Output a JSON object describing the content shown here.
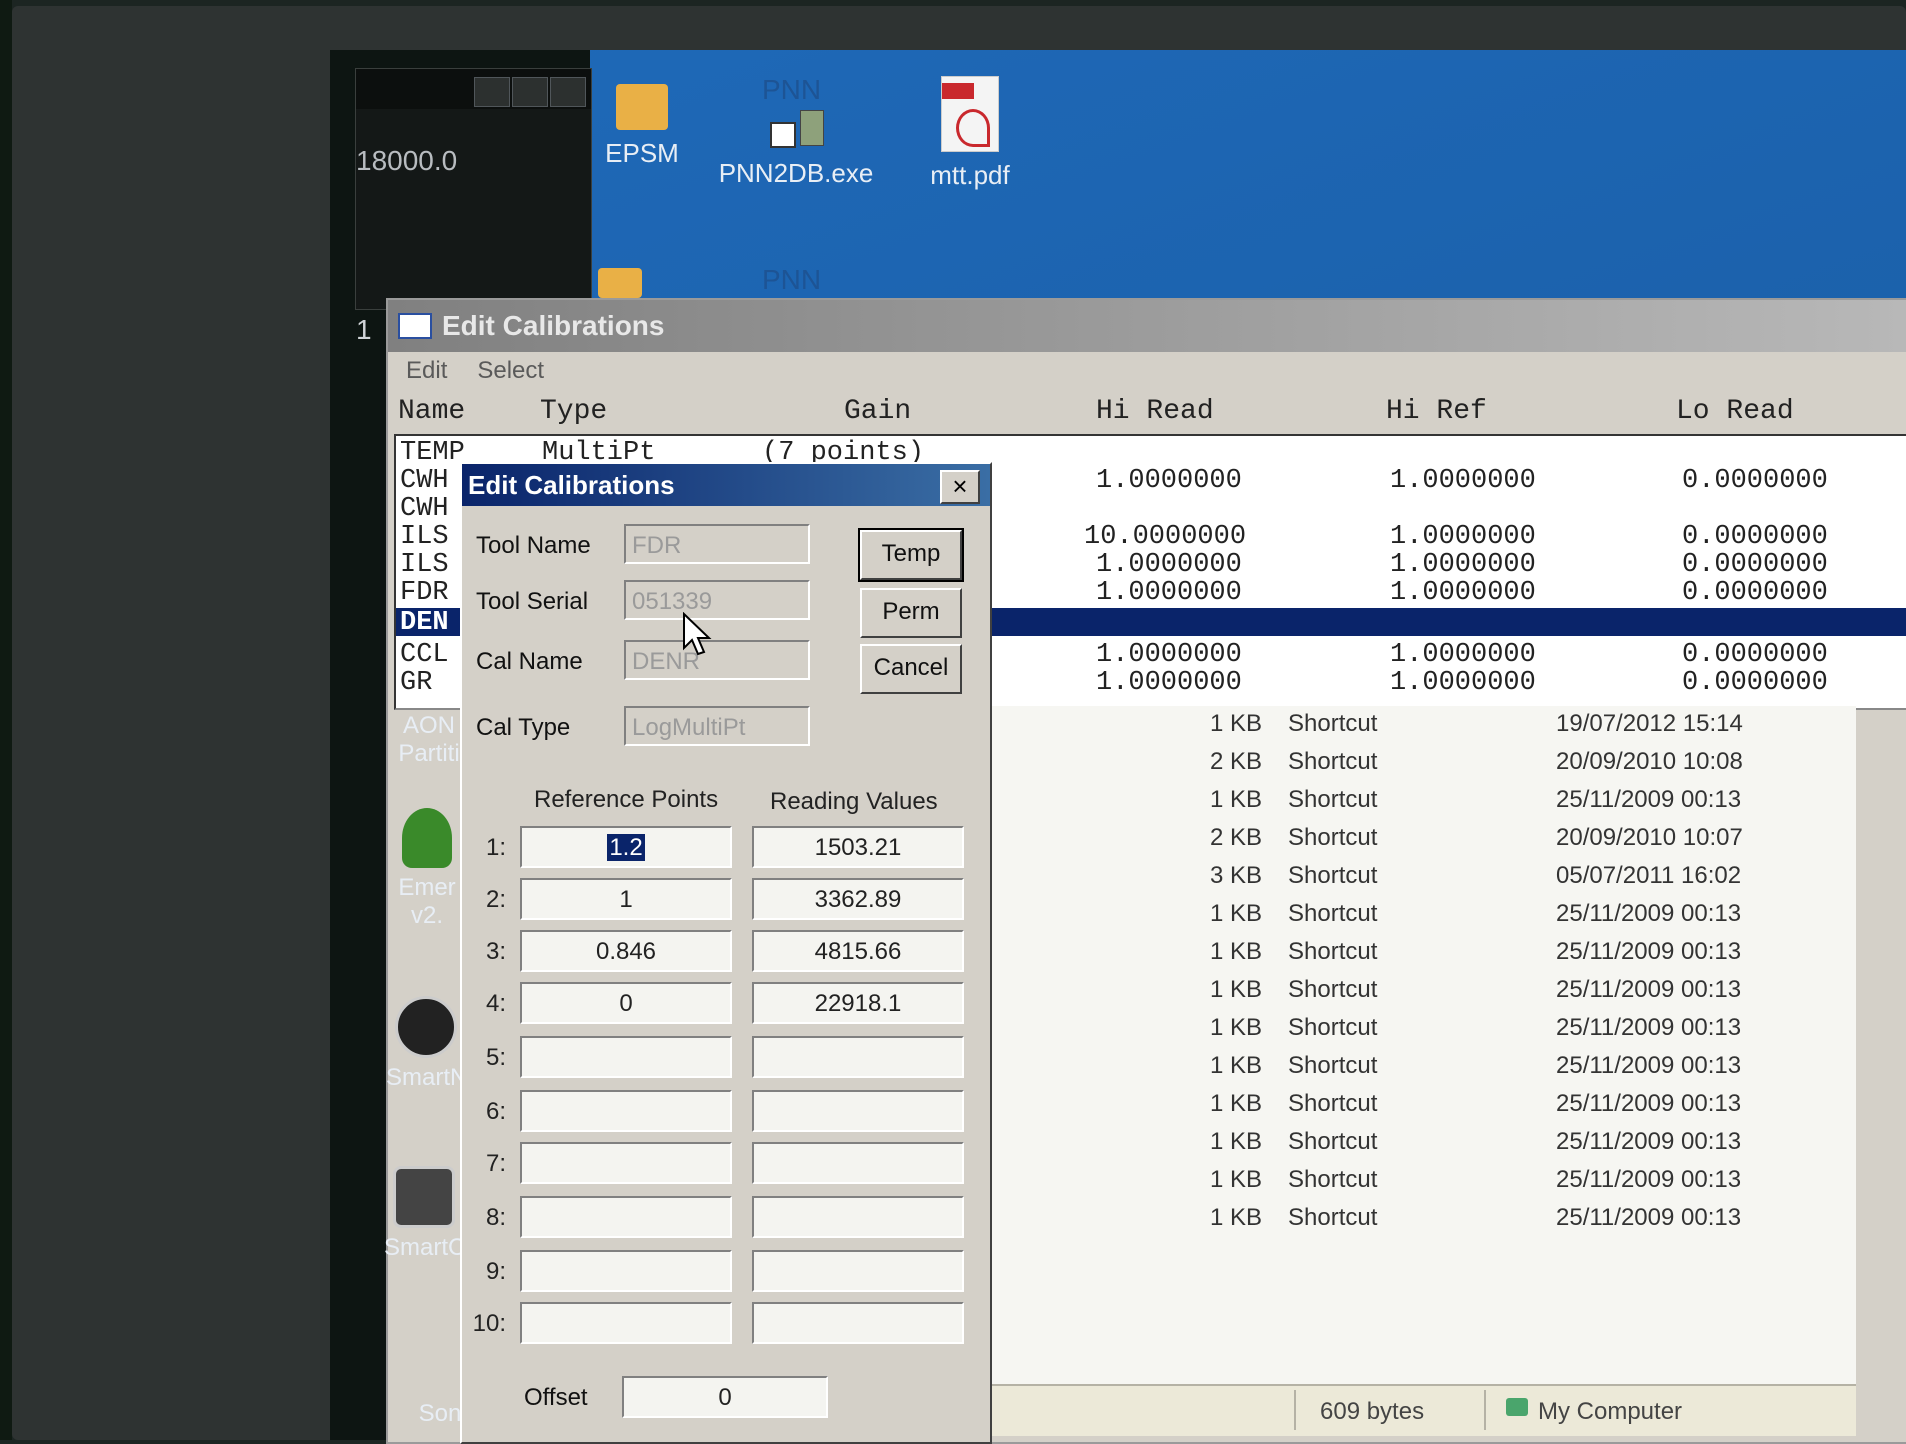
{
  "small_window": {
    "value": "18000.0"
  },
  "desktop_icons": [
    {
      "label": "EPSM",
      "top_label": ""
    },
    {
      "label": "PNN2DB.exe",
      "top_label": "PNN"
    },
    {
      "label": "mtt.pdf",
      "top_label": ""
    },
    {
      "label": "",
      "top_label": "PNN"
    }
  ],
  "left_edge_number": "1",
  "back_window": {
    "title": "Edit Calibrations",
    "menu": [
      "Edit",
      "Select"
    ],
    "columns": [
      "Name",
      "Type",
      "Gain",
      "Hi Read",
      "Hi Ref",
      "Lo Read"
    ],
    "rows": [
      {
        "name": "TEMP",
        "type": "MultiPt",
        "gain": "(7 points)",
        "hi_read": "",
        "hi_ref": "",
        "lo_read": ""
      },
      {
        "name": "CWH",
        "type": "",
        "gain": "",
        "hi_read": "1.0000000",
        "hi_ref": "1.0000000",
        "lo_read": "0.0000000"
      },
      {
        "name": "CWH",
        "type": "",
        "gain": "",
        "hi_read": "",
        "hi_ref": "",
        "lo_read": ""
      },
      {
        "name": "ILS",
        "type": "",
        "gain": "",
        "hi_read": "10.0000000",
        "hi_ref": "1.0000000",
        "lo_read": "0.0000000"
      },
      {
        "name": "ILS",
        "type": "",
        "gain": "",
        "hi_read": "1.0000000",
        "hi_ref": "1.0000000",
        "lo_read": "0.0000000"
      },
      {
        "name": "FDR",
        "type": "",
        "gain": "",
        "hi_read": "1.0000000",
        "hi_ref": "1.0000000",
        "lo_read": "0.0000000"
      },
      {
        "name": "DEN",
        "type": "",
        "gain": "",
        "hi_read": "",
        "hi_ref": "",
        "lo_read": ""
      },
      {
        "name": "CCL",
        "type": "",
        "gain": "",
        "hi_read": "1.0000000",
        "hi_ref": "1.0000000",
        "lo_read": "0.0000000"
      },
      {
        "name": "GR",
        "type": "",
        "gain": "",
        "hi_read": "1.0000000",
        "hi_ref": "1.0000000",
        "lo_read": "0.0000000"
      }
    ]
  },
  "left_icons": [
    {
      "label": "AON\nPartiti"
    },
    {
      "label": "Emer\nv2."
    },
    {
      "label": "SmartN"
    },
    {
      "label": "SmartC"
    },
    {
      "label": "Son"
    }
  ],
  "files": [
    {
      "size": "1 KB",
      "type": "Shortcut",
      "date": "19/07/2012 15:14"
    },
    {
      "size": "2 KB",
      "type": "Shortcut",
      "date": "20/09/2010 10:08"
    },
    {
      "size": "1 KB",
      "type": "Shortcut",
      "date": "25/11/2009 00:13"
    },
    {
      "size": "2 KB",
      "type": "Shortcut",
      "date": "20/09/2010 10:07"
    },
    {
      "size": "3 KB",
      "type": "Shortcut",
      "date": "05/07/2011 16:02"
    },
    {
      "size": "1 KB",
      "type": "Shortcut",
      "date": "25/11/2009 00:13"
    },
    {
      "size": "1 KB",
      "type": "Shortcut",
      "date": "25/11/2009 00:13"
    },
    {
      "size": "1 KB",
      "type": "Shortcut",
      "date": "25/11/2009 00:13"
    },
    {
      "size": "1 KB",
      "type": "Shortcut",
      "date": "25/11/2009 00:13"
    },
    {
      "size": "1 KB",
      "type": "Shortcut",
      "date": "25/11/2009 00:13"
    },
    {
      "size": "1 KB",
      "type": "Shortcut",
      "date": "25/11/2009 00:13"
    },
    {
      "size": "1 KB",
      "type": "Shortcut",
      "date": "25/11/2009 00:13"
    },
    {
      "size": "1 KB",
      "type": "Shortcut",
      "date": "25/11/2009 00:13"
    },
    {
      "size": "1 KB",
      "type": "Shortcut",
      "date": "25/11/2009 00:13"
    }
  ],
  "statusbar": {
    "size": "609 bytes",
    "location": "My Computer"
  },
  "dialog": {
    "title": "Edit Calibrations",
    "close": "×",
    "tool_name_label": "Tool Name",
    "tool_name": "FDR",
    "tool_serial_label": "Tool Serial",
    "tool_serial": "051339",
    "cal_name_label": "Cal Name",
    "cal_name": "DENR",
    "cal_type_label": "Cal Type",
    "cal_type": "LogMultiPt",
    "buttons": {
      "temp": "Temp",
      "perm": "Perm",
      "cancel": "Cancel"
    },
    "ref_header": "Reference Points",
    "read_header": "Reading Values",
    "points": [
      {
        "n": "1:",
        "ref": "1.2",
        "read": "1503.21"
      },
      {
        "n": "2:",
        "ref": "1",
        "read": "3362.89"
      },
      {
        "n": "3:",
        "ref": "0.846",
        "read": "4815.66"
      },
      {
        "n": "4:",
        "ref": "0",
        "read": "22918.1"
      },
      {
        "n": "5:",
        "ref": "",
        "read": ""
      },
      {
        "n": "6:",
        "ref": "",
        "read": ""
      },
      {
        "n": "7:",
        "ref": "",
        "read": ""
      },
      {
        "n": "8:",
        "ref": "",
        "read": ""
      },
      {
        "n": "9:",
        "ref": "",
        "read": ""
      },
      {
        "n": "10:",
        "ref": "",
        "read": ""
      }
    ],
    "offset_label": "Offset",
    "offset": "0"
  }
}
